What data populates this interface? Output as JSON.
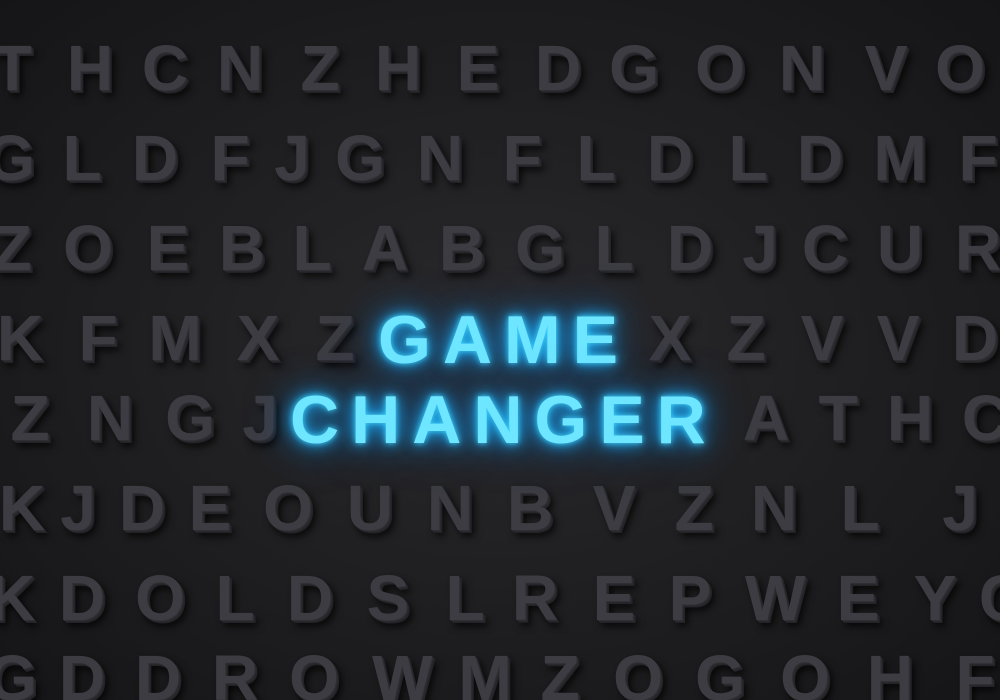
{
  "headline": {
    "line1": "GAME",
    "line2": "CHANGER",
    "glow_color": "#6fe6ff"
  },
  "background_rows": [
    [
      "T",
      "H",
      "C",
      "N",
      "Z",
      "H",
      "E",
      "D",
      "G",
      "O",
      "N",
      "V",
      "O"
    ],
    [
      "G",
      "L",
      "D",
      "F",
      "J",
      "G",
      "N",
      "F",
      "L",
      "D",
      "L",
      "D",
      "M",
      "F"
    ],
    [
      "Z",
      "O",
      "E",
      "B",
      "L",
      "A",
      "B",
      "G",
      "L",
      "D",
      "J",
      "C",
      "U",
      "R"
    ],
    [
      "K",
      "F",
      "M",
      "X",
      "Z",
      "X",
      "Z",
      "V",
      "V",
      "D"
    ],
    [
      "Z",
      "N",
      "G",
      "J",
      "A",
      "T",
      "H",
      "C"
    ],
    [
      "K",
      "J",
      "D",
      "E",
      "O",
      "U",
      "N",
      "B",
      "V",
      "Z",
      "N",
      "L",
      "J"
    ],
    [
      "K",
      "D",
      "O",
      "L",
      "D",
      "S",
      "L",
      "R",
      "E",
      "P",
      "W",
      "E",
      "Y",
      "C"
    ],
    [
      "G",
      "D",
      "D",
      "R",
      "O",
      "W",
      "M",
      "Z",
      "Q",
      "G",
      "O",
      "H",
      "F"
    ]
  ],
  "colors": {
    "background": "#1c1c1e",
    "letter": "#3c3c42",
    "glow": "#1fb8ff"
  }
}
